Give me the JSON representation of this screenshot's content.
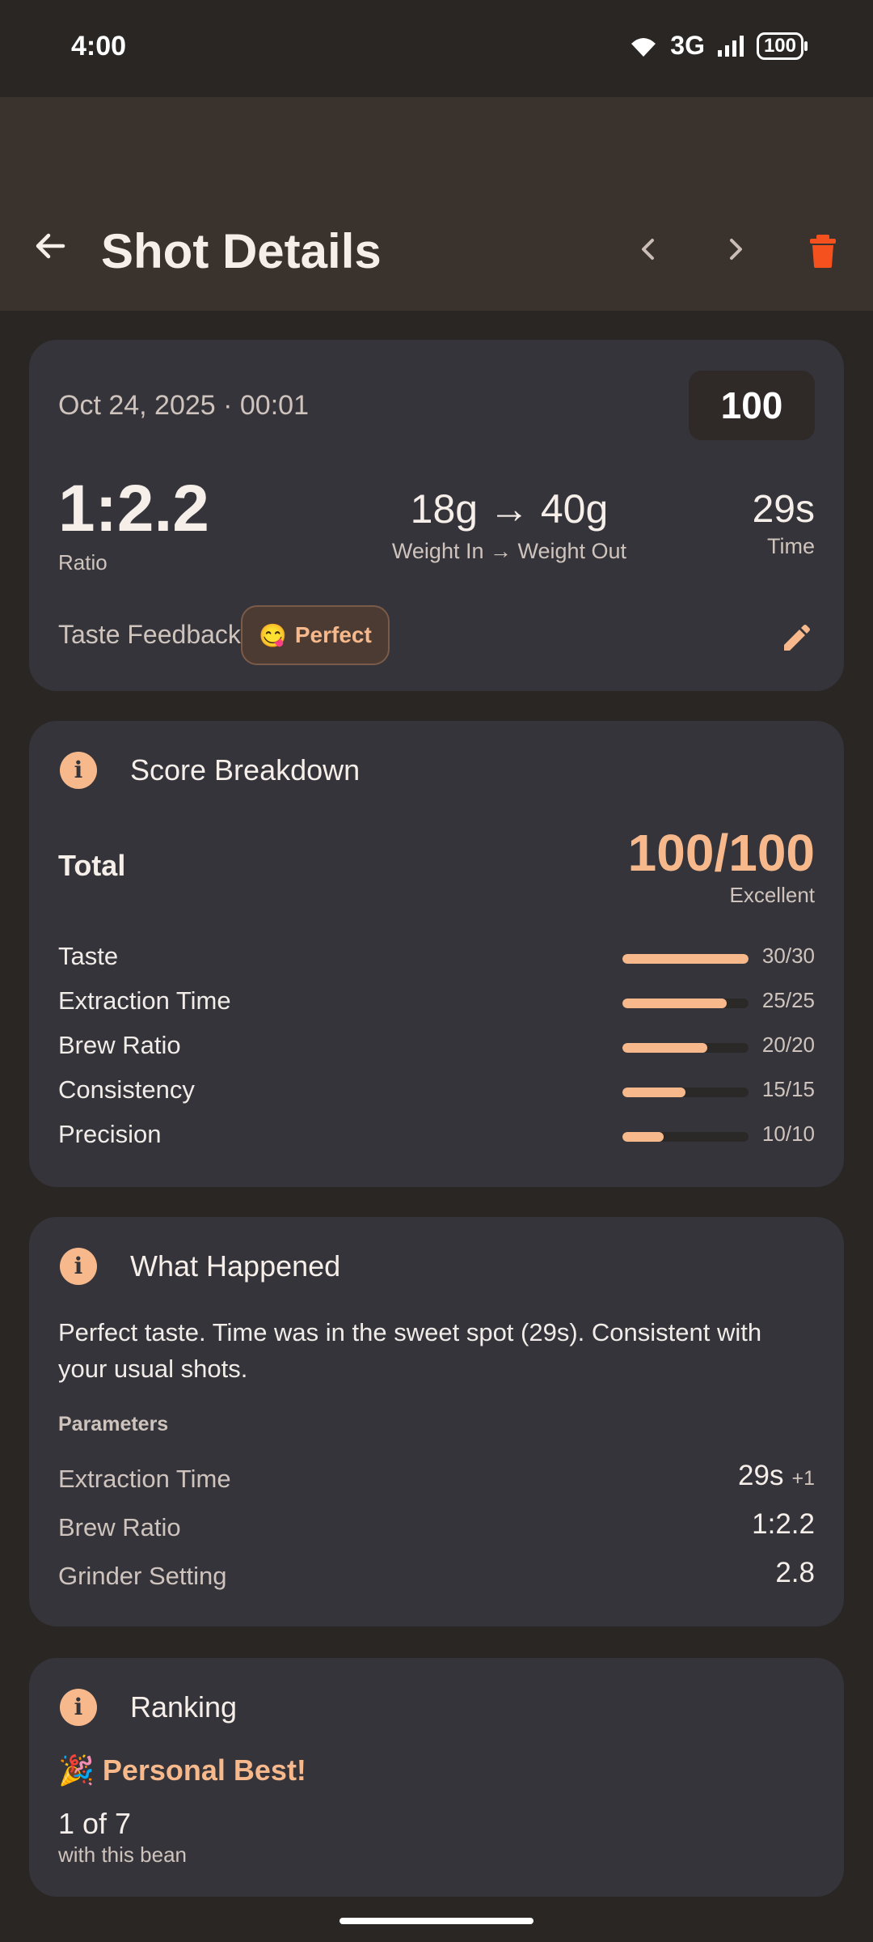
{
  "status_bar": {
    "time": "4:00",
    "network": "3G",
    "battery": "100"
  },
  "app_bar": {
    "title": "Shot Details"
  },
  "shot": {
    "date": "Oct 24, 2025 · 00:01",
    "score": "100",
    "ratio": "1:2.2",
    "ratio_label": "Ratio",
    "weights": "18g → 40g",
    "weights_label": "Weight In → Weight Out",
    "time": "29s",
    "time_label": "Time",
    "taste_feedback_label": "Taste Feedback",
    "taste_chip": {
      "emoji": "😋",
      "label": "Perfect"
    }
  },
  "score_breakdown": {
    "title": "Score Breakdown",
    "total_label": "Total",
    "total_value": "100/100",
    "total_rating": "Excellent",
    "rows": [
      {
        "label": "Taste",
        "score": "30/30",
        "fill": 1.0
      },
      {
        "label": "Extraction Time",
        "score": "25/25",
        "fill": 0.83
      },
      {
        "label": "Brew Ratio",
        "score": "20/20",
        "fill": 0.67
      },
      {
        "label": "Consistency",
        "score": "15/15",
        "fill": 0.5
      },
      {
        "label": "Precision",
        "score": "10/10",
        "fill": 0.33
      }
    ]
  },
  "what_happened": {
    "title": "What Happened",
    "summary": "Perfect taste. Time was in the sweet spot (29s). Consistent with your usual shots.",
    "params_heading": "Parameters",
    "params": [
      {
        "label": "Extraction Time",
        "value": "29s",
        "delta": "+1"
      },
      {
        "label": "Brew Ratio",
        "value": "1:2.2",
        "delta": ""
      },
      {
        "label": "Grinder Setting",
        "value": "2.8",
        "delta": ""
      }
    ]
  },
  "ranking": {
    "title": "Ranking",
    "badge": "🎉 Personal Best!",
    "position": "1 of 7",
    "context": "with this bean"
  },
  "colors": {
    "accent": "#f7b98c",
    "delete": "#f4511e",
    "card": "#35343a",
    "background": "#2a2623",
    "appbar": "#3a322d"
  }
}
